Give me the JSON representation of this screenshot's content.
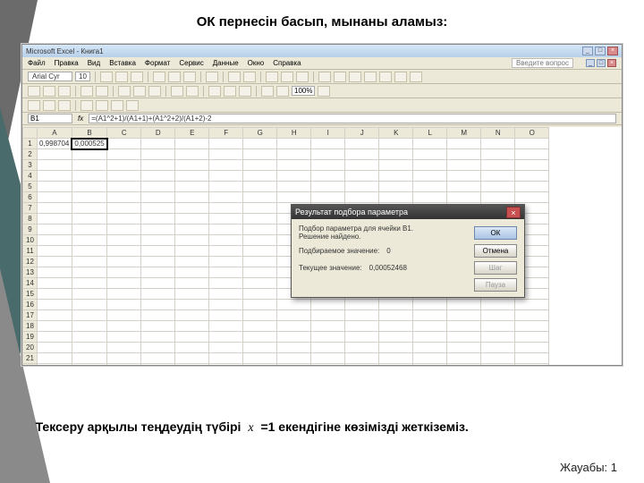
{
  "slide": {
    "title": "ОК пернесін басып, мынаны аламыз:",
    "check_text_before": "Тексеру арқылы теңдеудің түбірі",
    "check_var": "x",
    "check_text_after": " =1 екендігіне көзімізді жеткіземіз.",
    "answer_label": "Жауабы: 1"
  },
  "excel": {
    "app_title": "Microsoft Excel - Книга1",
    "help_prompt": "Введите вопрос",
    "menus": [
      "Файл",
      "Правка",
      "Вид",
      "Вставка",
      "Формат",
      "Сервис",
      "Данные",
      "Окно",
      "Справка"
    ],
    "font_name": "Arial Cyr",
    "font_size": "10",
    "zoom": "100%",
    "namebox": "B1",
    "formula": "=(A1^2+1)/(A1+1)+(A1^2+2)/(A1+2)-2",
    "columns": [
      "A",
      "B",
      "C",
      "D",
      "E",
      "F",
      "G",
      "H",
      "I",
      "J",
      "K",
      "L",
      "M",
      "N",
      "O"
    ],
    "row_count": 22,
    "cells": {
      "A1": "0,998704",
      "B1": "0,000525"
    },
    "selected_cell": "B1"
  },
  "dialog": {
    "title": "Результат подбора параметра",
    "line1": "Подбор параметра для ячейки B1.",
    "line2": "Решение найдено.",
    "target_label": "Подбираемое значение:",
    "target_value": "0",
    "current_label": "Текущее значение:",
    "current_value": "0,00052468",
    "btn_ok": "ОК",
    "btn_cancel": "Отмена",
    "btn_step": "Шаг",
    "btn_pause": "Пауза"
  }
}
